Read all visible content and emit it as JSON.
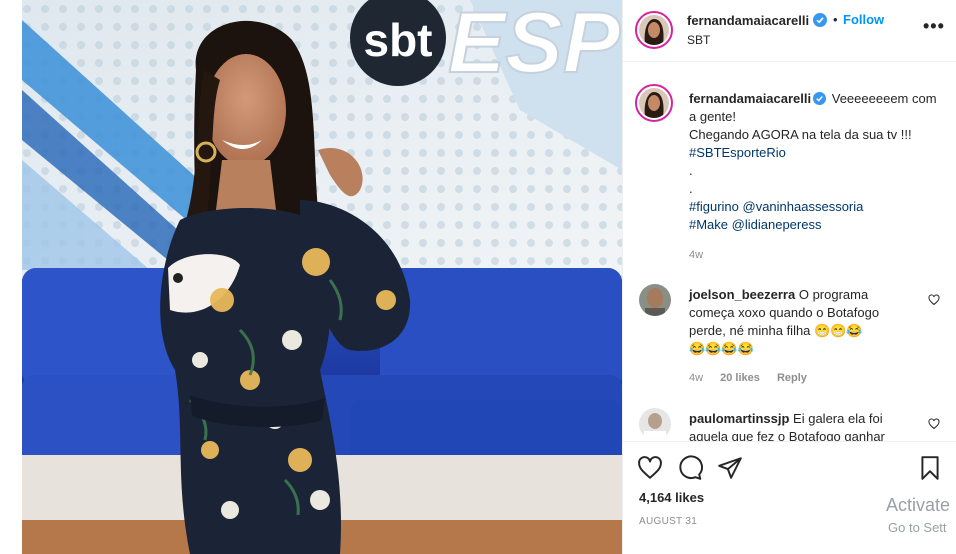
{
  "post": {
    "username": "fernandamaiacarelli",
    "follow_label": "Follow",
    "dot": "•",
    "location": "SBT",
    "more_label": "•••",
    "photo": {
      "logo": "sbt",
      "sign": "ESPO"
    }
  },
  "caption": {
    "username": "fernandamaiacarelli",
    "lines": [
      "Veeeeeeeem com a gente!",
      "Chegando AGORA na tela da sua tv !!!"
    ],
    "hashtag1": "#SBTEsporteRio",
    "dot1": ".",
    "dot2": ".",
    "line_figurino_tag": "#figurino",
    "line_figurino_mention": "@vaninhaassessoria",
    "line_make_tag": "#Make",
    "line_make_mention": "@lidianeperess",
    "time_ago": "4w"
  },
  "comments": [
    {
      "username": "joelson_beezerra",
      "text": "O programa começa xoxo quando o Botafogo perde, né minha filha 😁😁😂",
      "emoji_line": "😂😂😂😂",
      "time_ago": "4w",
      "likes": "20 likes",
      "reply_label": "Reply"
    },
    {
      "username": "paulomartinssjp",
      "text": "Ei galera ela foi aquela que fez o Botafogo ganhar"
    }
  ],
  "actions": {
    "like_icon": "heart-icon",
    "comment_icon": "comment-icon",
    "share_icon": "share-icon",
    "save_icon": "bookmark-icon",
    "likes": "4,164 likes",
    "date": "AUGUST 31"
  },
  "system": {
    "activate_title": "Activate",
    "activate_sub": "Go to Sett"
  },
  "colors": {
    "link": "#00376b",
    "follow": "#0095f6",
    "verified": "#3897f0",
    "secondary_text": "#8e8e8e"
  }
}
